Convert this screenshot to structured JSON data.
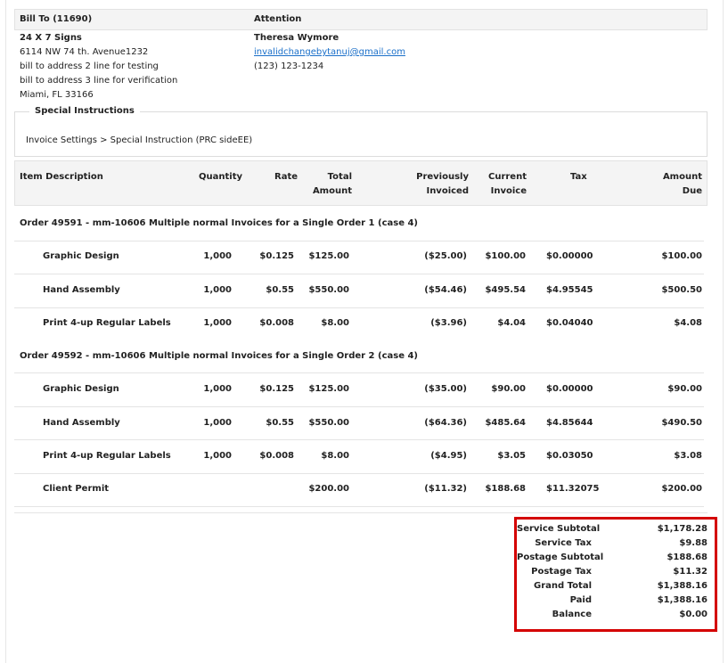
{
  "bill_to": {
    "heading": "Bill To (11690)",
    "company": "24 X 7 Signs",
    "lines": [
      "6114 NW 74 th. Avenue1232",
      "bill to address 2 line for testing",
      "bill to address 3 line for verification",
      "Miami, FL 33166"
    ]
  },
  "attention": {
    "heading": "Attention",
    "name": "Theresa Wymore",
    "email": "invalidchangebytanuj@gmail.com",
    "phone": "(123) 123-1234"
  },
  "special_instructions": {
    "legend": "Special Instructions",
    "text": "Invoice Settings > Special Instruction (PRC sideEE)"
  },
  "table": {
    "headers": {
      "item": "Item Description",
      "qty": "Quantity",
      "rate": "Rate",
      "total_1": "Total",
      "total_2": "Amount",
      "prev_1": "Previously",
      "prev_2": "Invoiced",
      "cur_1": "Current",
      "cur_2": "Invoice",
      "tax": "Tax",
      "due_1": "Amount",
      "due_2": "Due"
    },
    "groups": [
      {
        "title": "Order 49591 - mm-10606 Multiple normal Invoices for a Single Order 1 (case 4)",
        "rows": [
          {
            "item": "Graphic Design",
            "qty": "1,000",
            "rate": "$0.125",
            "total": "$125.00",
            "prev": "($25.00)",
            "cur": "$100.00",
            "tax": "$0.00000",
            "due": "$100.00"
          },
          {
            "item": "Hand Assembly",
            "qty": "1,000",
            "rate": "$0.55",
            "total": "$550.00",
            "prev": "($54.46)",
            "cur": "$495.54",
            "tax": "$4.95545",
            "due": "$500.50"
          },
          {
            "item": "Print 4-up Regular Labels",
            "qty": "1,000",
            "rate": "$0.008",
            "total": "$8.00",
            "prev": "($3.96)",
            "cur": "$4.04",
            "tax": "$0.04040",
            "due": "$4.08"
          }
        ]
      },
      {
        "title": "Order 49592 - mm-10606 Multiple normal Invoices for a Single Order 2 (case 4)",
        "rows": [
          {
            "item": "Graphic Design",
            "qty": "1,000",
            "rate": "$0.125",
            "total": "$125.00",
            "prev": "($35.00)",
            "cur": "$90.00",
            "tax": "$0.00000",
            "due": "$90.00"
          },
          {
            "item": "Hand Assembly",
            "qty": "1,000",
            "rate": "$0.55",
            "total": "$550.00",
            "prev": "($64.36)",
            "cur": "$485.64",
            "tax": "$4.85644",
            "due": "$490.50"
          },
          {
            "item": "Print 4-up Regular Labels",
            "qty": "1,000",
            "rate": "$0.008",
            "total": "$8.00",
            "prev": "($4.95)",
            "cur": "$3.05",
            "tax": "$0.03050",
            "due": "$3.08"
          },
          {
            "item": "Client Permit",
            "qty": "",
            "rate": "",
            "total": "$200.00",
            "prev": "($11.32)",
            "cur": "$188.68",
            "tax": "$11.32075",
            "due": "$200.00"
          }
        ]
      }
    ]
  },
  "totals": [
    {
      "label": "Service Subtotal",
      "value": "$1,178.28"
    },
    {
      "label": "Service Tax",
      "value": "$9.88"
    },
    {
      "label": "Postage Subtotal",
      "value": "$188.68"
    },
    {
      "label": "Postage Tax",
      "value": "$11.32"
    },
    {
      "label": "Grand Total",
      "value": "$1,388.16"
    },
    {
      "label": "Paid",
      "value": "$1,388.16"
    },
    {
      "label": "Balance",
      "value": "$0.00"
    }
  ],
  "colors": {
    "highlight_border": "#d40000",
    "link": "#1a6fc9"
  }
}
